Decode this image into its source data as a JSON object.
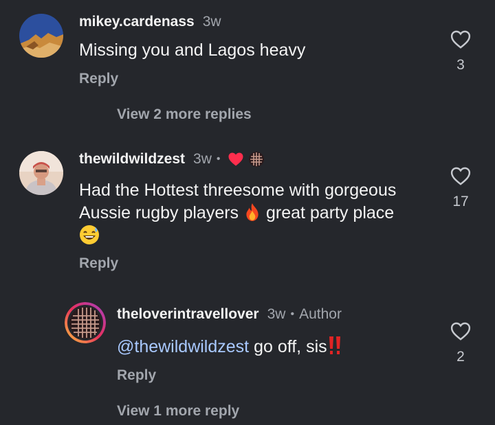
{
  "comments": [
    {
      "username": "mikey.cardenass",
      "time": "3w",
      "text": "Missing you and Lagos heavy",
      "reply_label": "Reply",
      "like_count": "3",
      "view_more": "View 2 more replies"
    },
    {
      "username": "thewildwildzest",
      "time": "3w",
      "dot": "•",
      "text_line1": "Had the Hottest threesome with gorgeous",
      "text_line2_a": "Aussie rugby players",
      "text_line2_b": "great party place",
      "reply_label": "Reply",
      "like_count": "17"
    },
    {
      "username": "theloverintravellover",
      "time": "3w",
      "dot": "•",
      "author_label": "Author",
      "mention": "@thewildwildzest",
      "text": "go off, sis",
      "reply_label": "Reply",
      "like_count": "2",
      "view_more": "View 1 more reply"
    }
  ],
  "icons": {
    "like": "heart-outline-icon",
    "liked_by_author": "heart-filled-icon",
    "fire": "fire-emoji",
    "laugh": "grinning-sweat-emoji",
    "exclamation": "double-exclamation-emoji"
  },
  "colors": {
    "background": "#25272c",
    "secondary_text": "#a2a6ad",
    "mention": "#a9c9ff",
    "heart": "#ff2e4d"
  }
}
